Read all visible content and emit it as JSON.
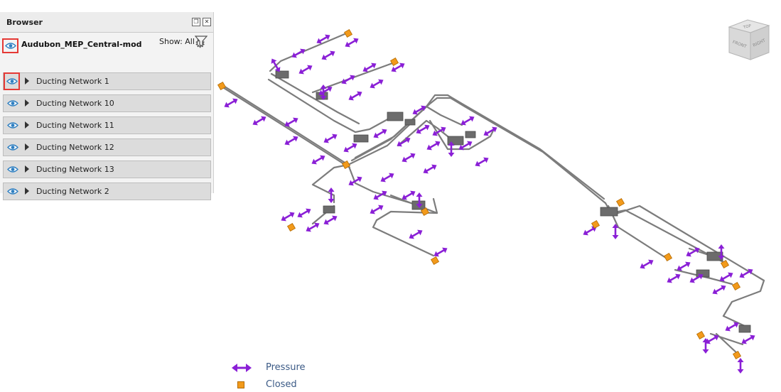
{
  "browser": {
    "title": "Browser",
    "model_name": "Audubon_MEP_Central-mod",
    "show_label": "Show: All",
    "networks": [
      {
        "label": "Ducting Network 1",
        "highlighted": true
      },
      {
        "label": "Ducting Network 10",
        "highlighted": false
      },
      {
        "label": "Ducting Network 11",
        "highlighted": false
      },
      {
        "label": "Ducting Network 12",
        "highlighted": false
      },
      {
        "label": "Ducting Network 13",
        "highlighted": false
      },
      {
        "label": "Ducting Network 2",
        "highlighted": false
      }
    ]
  },
  "viewcube": {
    "top": "TOP",
    "front": "FRONT",
    "right": "RIGHT"
  },
  "legend": {
    "pressure_label": "Pressure",
    "closed_label": "Closed",
    "pressure_color": "#8a1fd6",
    "closed_color": "#f29a1b"
  },
  "colors": {
    "highlight": "#e53935",
    "eye": "#2f7fc1",
    "duct": "#7c7c7c"
  }
}
